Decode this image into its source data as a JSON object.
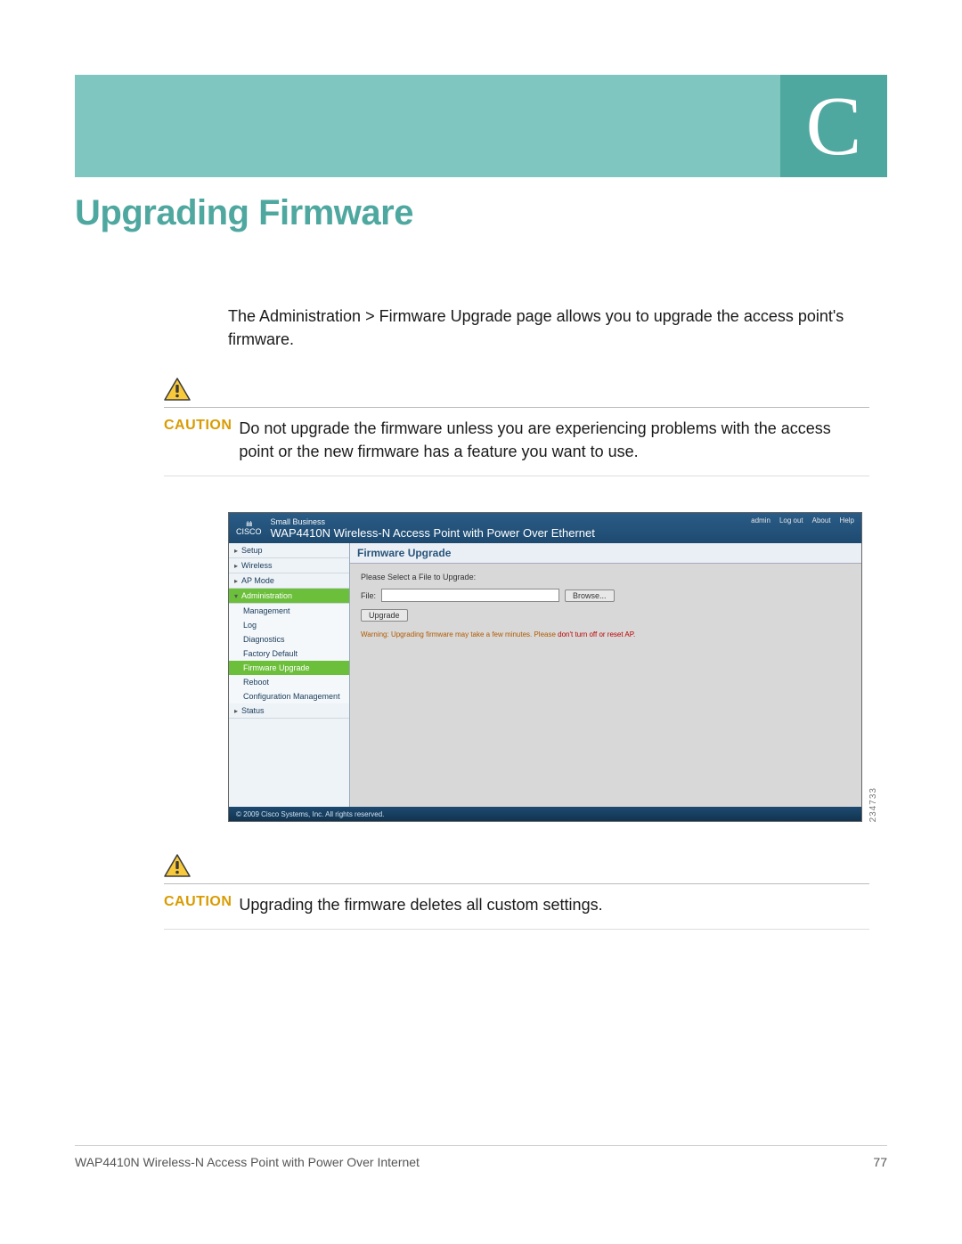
{
  "appendix_letter": "C",
  "title": "Upgrading Firmware",
  "intro": "The Administration > Firmware Upgrade page allows you to upgrade the access point's firmware.",
  "caution_label": "CAUTION",
  "caution1": "Do not upgrade the firmware unless you are experiencing problems with the access point or the new firmware has a feature you want to use.",
  "caution2": "Upgrading the firmware deletes all custom settings.",
  "image_id": "234733",
  "footer": {
    "product": "WAP4410N Wireless-N Access Point with Power Over Internet",
    "page": "77"
  },
  "shot": {
    "brand_top": "ılıılı",
    "brand": "CISCO",
    "smallbiz": "Small Business",
    "product": "WAP4410N Wireless-N Access Point with Power Over Ethernet",
    "links": {
      "admin": "admin",
      "logout": "Log out",
      "about": "About",
      "help": "Help"
    },
    "nav": {
      "setup": "Setup",
      "wireless": "Wireless",
      "apmode": "AP Mode",
      "admin": "Administration",
      "admin_subs": {
        "management": "Management",
        "log": "Log",
        "diagnostics": "Diagnostics",
        "factory": "Factory Default",
        "firmware": "Firmware Upgrade",
        "reboot": "Reboot",
        "config": "Configuration Management"
      },
      "status": "Status"
    },
    "panel": {
      "title": "Firmware Upgrade",
      "prompt": "Please Select a File to Upgrade:",
      "file_label": "File:",
      "browse": "Browse...",
      "upgrade": "Upgrade",
      "warning_label": "Warning:",
      "warning_text1": "Upgrading firmware may take a few minutes. Please ",
      "warning_text2": "don't turn off or reset AP."
    },
    "copyright": "© 2009 Cisco Systems, Inc. All rights reserved."
  }
}
